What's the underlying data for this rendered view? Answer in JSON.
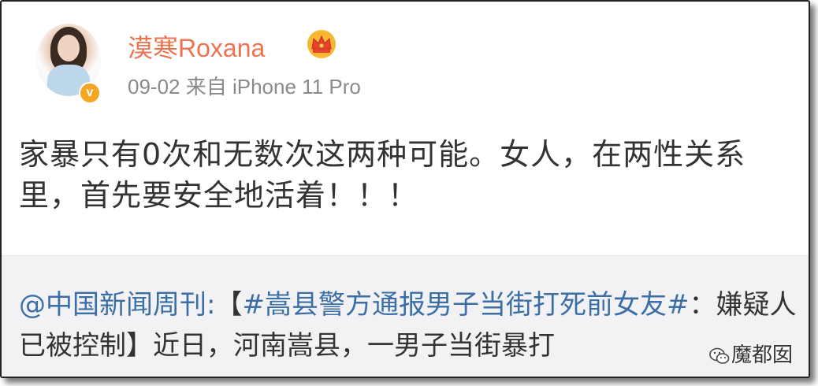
{
  "post": {
    "username": "漠寒Roxana",
    "timestamp": "09-02",
    "source": "来自 iPhone 11 Pro",
    "verified_badge": "v",
    "text": "家暴只有0次和无数次这两种可能。女人，在两性关系里，首先要安全地活着！！！"
  },
  "repost": {
    "source_account": "@中国新闻周刊:",
    "bracket_open": "【",
    "hashtag": "#嵩县警方通报男子当街打死前女友#",
    "headline_rest": "：嫌疑人已被控制】",
    "body_start": "近日，河南嵩县，一男子当街暴打"
  },
  "watermark": {
    "text": "魔都囡"
  },
  "colors": {
    "username": "#eb7350",
    "meta": "#8a8a8a",
    "link": "#3b6ea5",
    "repost_bg": "#f2f2f5",
    "verified": "#f5a623"
  }
}
